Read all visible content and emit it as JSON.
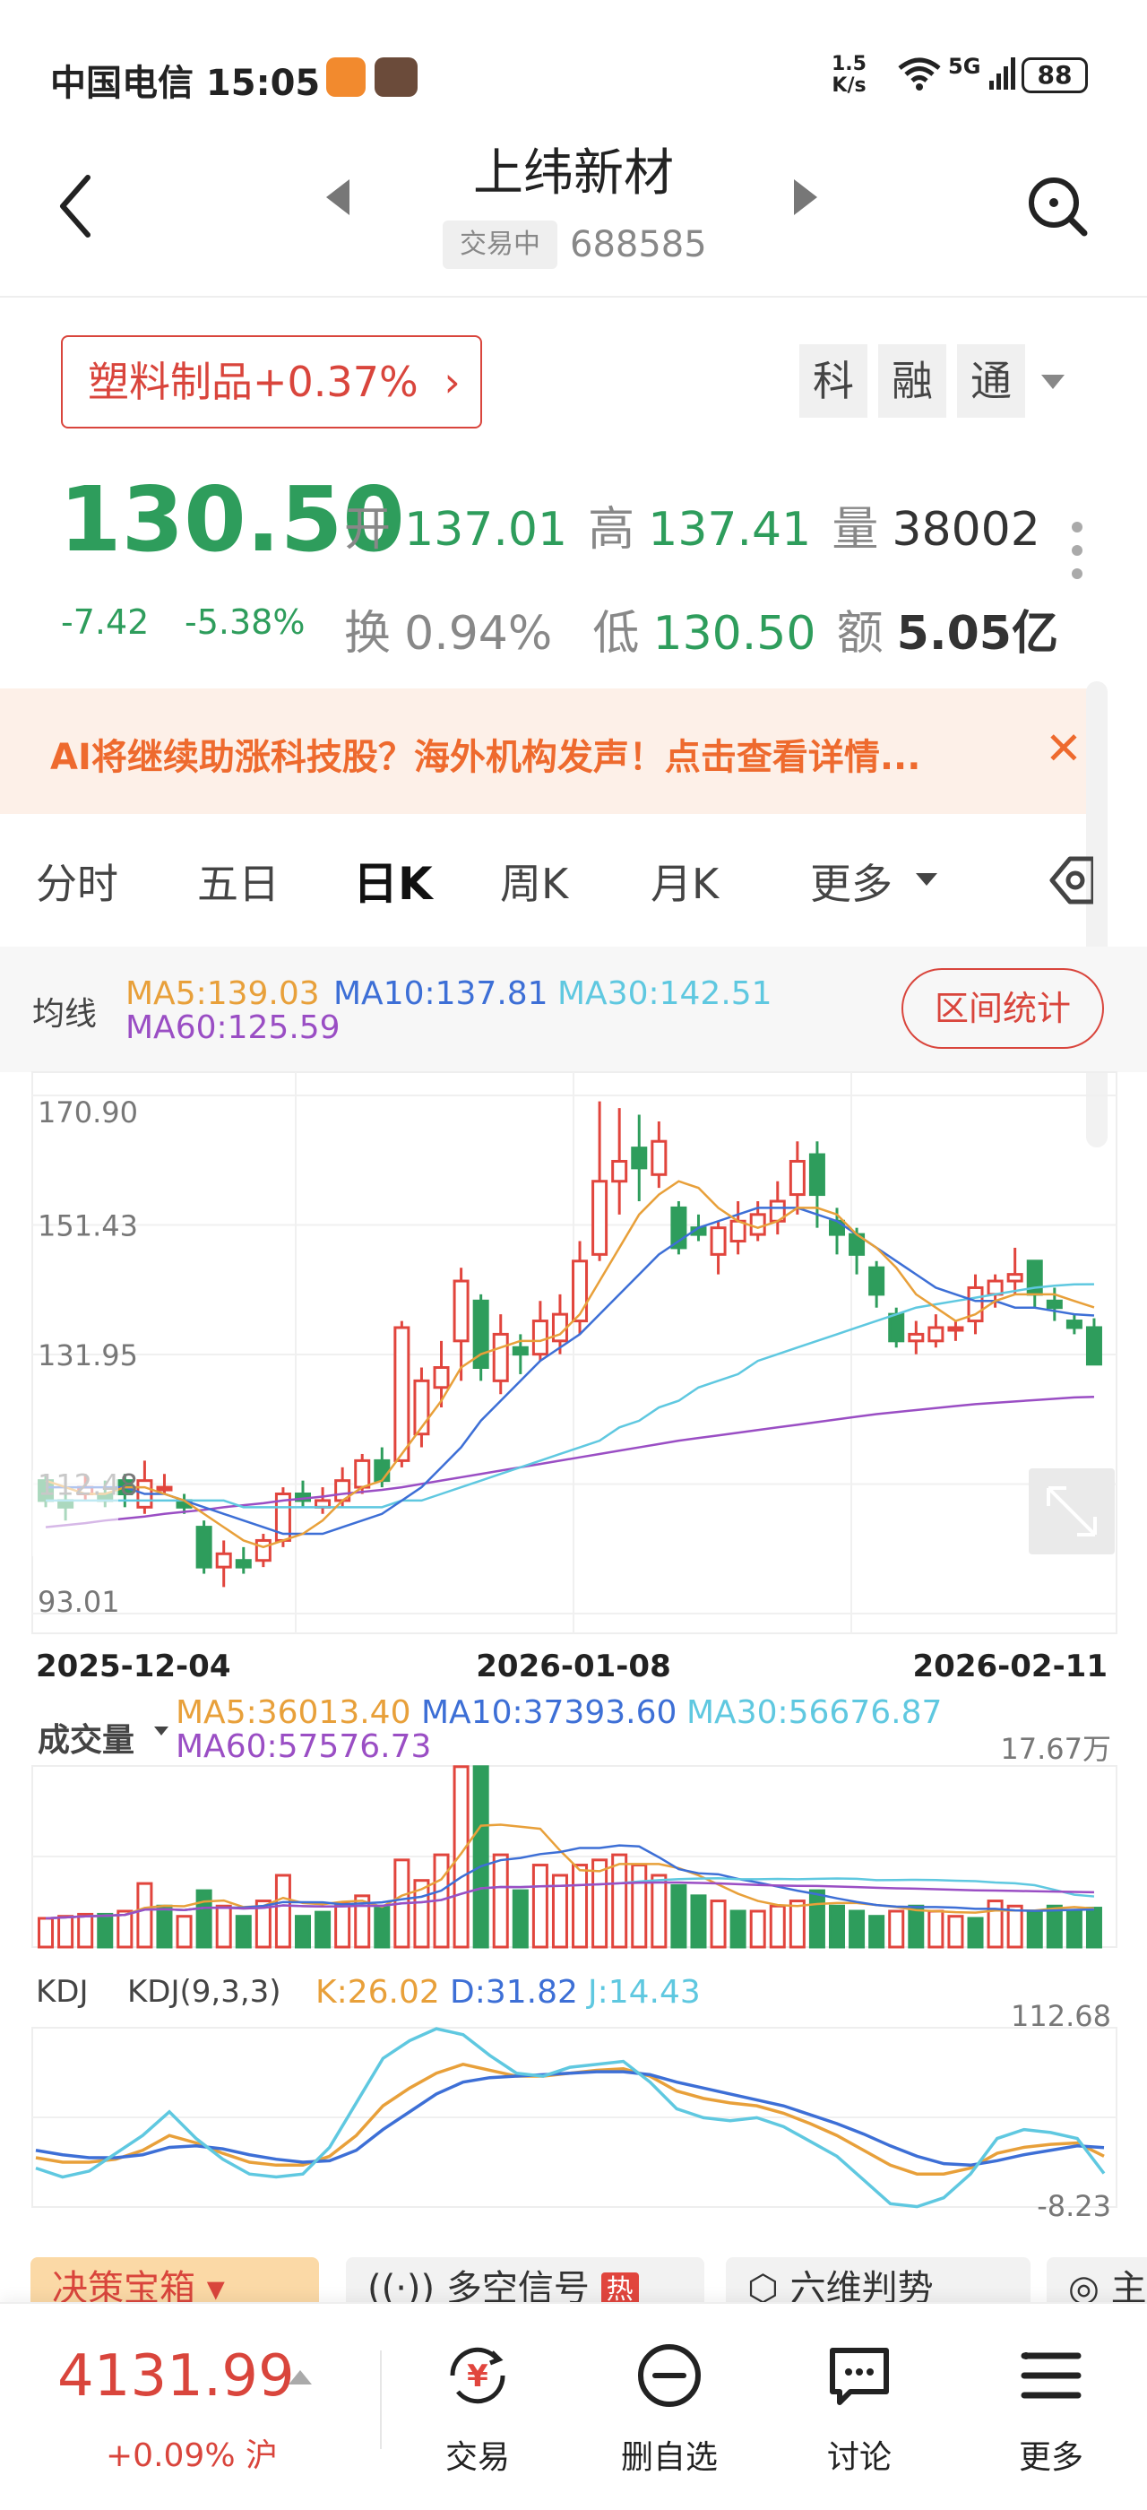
{
  "status_bar": {
    "carrier_time": "中国电信 15:05",
    "net_speed_value": "1.5",
    "net_speed_unit": "K/s",
    "network": "5G",
    "battery": "88"
  },
  "header": {
    "title": "上纬新材",
    "trade_state": "交易中",
    "code": "688585"
  },
  "sector": {
    "label": "塑料制品+0.37%",
    "tags": [
      "科",
      "融",
      "通"
    ]
  },
  "quote": {
    "price": "130.50",
    "change": "-7.42",
    "change_pct": "-5.38%",
    "open_label": "开",
    "open": "137.01",
    "high_label": "高",
    "high": "137.41",
    "volume_label": "量",
    "volume": "38002",
    "turnover_label": "换",
    "turnover": "0.94%",
    "low_label": "低",
    "low": "130.50",
    "amount_label": "额",
    "amount": "5.05亿"
  },
  "banner": {
    "text": "AI将继续助涨科技股？海外机构发声！点击查看详情...",
    "close": "✕"
  },
  "tabs": [
    "分时",
    "五日",
    "日K",
    "周K",
    "月K",
    "更多"
  ],
  "ma_legend": {
    "label": "均线",
    "ma5": "MA5:139.03",
    "ma10": "MA10:137.81",
    "ma30": "MA30:142.51",
    "ma60": "MA60:125.59",
    "range_button": "区间统计"
  },
  "colors": {
    "up": "#e1453d",
    "down": "#2e9d5c",
    "ma5": "#e8a03a",
    "ma10": "#3d6fd6",
    "ma30": "#5fc8e0",
    "ma60": "#9a4ec4"
  },
  "price_axis": [
    "170.90",
    "151.43",
    "131.95",
    "112.48",
    "93.01"
  ],
  "date_axis": [
    "2025-12-04",
    "2026-01-08",
    "2026-02-11"
  ],
  "volume_legend": {
    "label": "成交量",
    "ma5": "MA5:36013.40",
    "ma10": "MA10:37393.60",
    "ma30": "MA30:56676.87",
    "ma60": "MA60:57576.73",
    "max": "17.67万"
  },
  "kdj_legend": {
    "label": "KDJ",
    "param": "KDJ(9,3,3)",
    "k": "K:26.02",
    "d": "D:31.82",
    "j": "J:14.43",
    "max": "112.68",
    "min": "-8.23"
  },
  "chips": [
    "决策宝箱",
    "多空信号",
    "热",
    "六维判势",
    "主"
  ],
  "bottom_nav": {
    "index_value": "4131.99",
    "index_change": "+0.09% 沪",
    "items": [
      "交易",
      "删自选",
      "讨论",
      "更多"
    ]
  },
  "chart_data": [
    {
      "type": "candlestick",
      "ylim": [
        93.01,
        170.9
      ],
      "ticks": [
        "170.90",
        "151.43",
        "131.95",
        "112.48",
        "93.01"
      ],
      "x_labels": [
        "2025-12-04",
        "2026-01-08",
        "2026-02-11"
      ],
      "candles": [
        [
          113,
          110,
          114,
          109
        ],
        [
          110,
          109,
          112,
          107
        ],
        [
          111,
          112,
          114,
          110
        ],
        [
          111,
          110,
          113,
          109
        ],
        [
          113,
          111,
          114,
          109
        ],
        [
          109,
          113,
          116,
          108
        ],
        [
          112,
          112,
          114,
          111
        ],
        [
          110,
          109,
          111,
          108
        ],
        [
          106,
          100,
          107,
          99
        ],
        [
          100,
          102,
          104,
          97
        ],
        [
          101,
          100,
          103,
          99
        ],
        [
          101,
          104,
          105,
          100
        ],
        [
          104,
          111,
          112,
          103
        ],
        [
          111,
          110,
          113,
          109
        ],
        [
          109,
          110,
          112,
          108
        ],
        [
          110,
          113,
          115,
          109
        ],
        [
          112,
          116,
          117,
          111
        ],
        [
          116,
          113,
          118,
          112
        ],
        [
          116,
          136,
          137,
          115
        ],
        [
          120,
          128,
          130,
          118
        ],
        [
          127,
          130,
          134,
          124
        ],
        [
          134,
          143,
          145,
          128
        ],
        [
          140,
          130,
          141,
          128
        ],
        [
          128,
          135,
          138,
          126
        ],
        [
          133,
          132,
          135,
          129
        ],
        [
          132,
          137,
          140,
          131
        ],
        [
          134,
          138,
          141,
          132
        ],
        [
          137,
          146,
          149,
          135
        ],
        [
          147,
          158,
          170,
          146
        ],
        [
          158,
          161,
          169,
          153
        ],
        [
          163,
          160,
          168,
          155
        ],
        [
          159,
          164,
          167,
          157
        ],
        [
          154,
          148,
          155,
          147
        ],
        [
          151,
          150,
          153,
          149
        ],
        [
          147,
          151,
          152,
          144
        ],
        [
          149,
          152,
          155,
          147
        ],
        [
          150,
          153,
          155,
          149
        ],
        [
          152,
          155,
          158,
          150
        ],
        [
          156,
          161,
          164,
          153
        ],
        [
          162,
          156,
          164,
          151
        ],
        [
          152,
          150,
          154,
          147
        ],
        [
          150,
          147,
          151,
          144
        ],
        [
          145,
          141,
          146,
          139
        ],
        [
          138,
          134,
          139,
          133
        ],
        [
          134,
          135,
          137,
          132
        ],
        [
          134,
          136,
          138,
          133
        ],
        [
          136,
          136,
          137,
          134
        ],
        [
          137,
          142,
          144,
          135
        ],
        [
          141,
          143,
          144,
          139
        ],
        [
          143,
          144,
          148,
          141
        ],
        [
          146,
          141,
          146,
          139
        ],
        [
          140,
          139,
          142,
          137
        ],
        [
          137,
          136,
          138,
          135
        ],
        [
          136,
          130.5,
          137.4,
          130.5
        ]
      ],
      "ma5": [
        113,
        112,
        111,
        111,
        112,
        112,
        111,
        110,
        108,
        106,
        104,
        103,
        104,
        105,
        107,
        110,
        112,
        113,
        117,
        121,
        125,
        130,
        132,
        133,
        134,
        134,
        135,
        138,
        143,
        148,
        153,
        156,
        158,
        157,
        154,
        152,
        151,
        152,
        154,
        154,
        153,
        150,
        148,
        145,
        141,
        139,
        137,
        138,
        140,
        141,
        141,
        141,
        140,
        139.03
      ],
      "ma10": [
        112,
        112,
        112,
        112,
        112,
        111,
        111,
        110,
        109,
        108,
        107,
        106,
        105,
        105,
        105,
        106,
        107,
        108,
        110,
        112,
        115,
        118,
        122,
        125,
        128,
        131,
        133,
        135,
        138,
        141,
        144,
        147,
        149,
        151,
        152,
        153,
        154,
        154,
        154,
        153,
        152,
        150,
        148,
        146,
        144,
        142,
        141,
        140,
        140,
        139,
        139,
        138.5,
        138,
        137.81
      ],
      "ma30": [
        110,
        110,
        110,
        110,
        110,
        110,
        110,
        110,
        110,
        110,
        109,
        109,
        109,
        109,
        109,
        109,
        109,
        109,
        110,
        110,
        111,
        112,
        113,
        114,
        115,
        116,
        117,
        118,
        119,
        121,
        122,
        124,
        125,
        127,
        128,
        129,
        131,
        132,
        133,
        134,
        135,
        136,
        137,
        138,
        139,
        139.5,
        140,
        140.5,
        141,
        141.5,
        142,
        142.3,
        142.5,
        142.51
      ],
      "ma60": [
        106,
        106.3,
        106.6,
        107,
        107.3,
        107.6,
        108,
        108.3,
        108.6,
        109,
        109.3,
        109.6,
        110,
        110.3,
        110.6,
        111,
        111.3,
        111.6,
        112,
        112.5,
        113,
        113.5,
        114,
        114.5,
        115,
        115.5,
        116,
        116.5,
        117,
        117.5,
        118,
        118.5,
        119,
        119.4,
        119.8,
        120.2,
        120.6,
        121,
        121.4,
        121.8,
        122.2,
        122.6,
        123,
        123.3,
        123.6,
        123.9,
        124.2,
        124.5,
        124.7,
        124.9,
        125.1,
        125.3,
        125.5,
        125.59
      ]
    },
    {
      "type": "bar",
      "title": "成交量",
      "unit": "万",
      "ylim": [
        0,
        17.67
      ],
      "values": [
        2.8,
        3.0,
        3.2,
        3.2,
        3.5,
        6.2,
        4.0,
        3.0,
        5.5,
        4.0,
        3.0,
        4.5,
        7.0,
        3.0,
        3.4,
        4.2,
        5.0,
        4.0,
        8.5,
        6.5,
        9.0,
        17.6,
        17.6,
        9.0,
        5.5,
        8.0,
        7.0,
        8.0,
        8.5,
        9.0,
        8.0,
        7.0,
        6.0,
        5.0,
        4.5,
        3.5,
        3.5,
        4.0,
        4.5,
        5.5,
        4.0,
        3.5,
        3.0,
        3.5,
        4.0,
        3.5,
        3.0,
        2.8,
        4.5,
        4.0,
        3.5,
        4.0,
        3.5,
        3.8
      ],
      "up": [
        true,
        true,
        true,
        false,
        true,
        true,
        false,
        true,
        false,
        true,
        false,
        true,
        true,
        false,
        false,
        true,
        true,
        false,
        true,
        true,
        true,
        true,
        false,
        true,
        false,
        true,
        true,
        true,
        true,
        true,
        true,
        true,
        false,
        false,
        true,
        false,
        true,
        true,
        true,
        false,
        false,
        false,
        false,
        true,
        false,
        true,
        true,
        false,
        true,
        true,
        false,
        false,
        false,
        false
      ]
    },
    {
      "type": "line",
      "title": "KDJ(9,3,3)",
      "ylim": [
        -8.23,
        112.68
      ],
      "series": [
        {
          "name": "K",
          "values": [
            25,
            22,
            22,
            24,
            30,
            40,
            35,
            28,
            22,
            20,
            20,
            26,
            40,
            60,
            72,
            82,
            88,
            84,
            80,
            80,
            82,
            84,
            85,
            80,
            70,
            65,
            62,
            60,
            55,
            48,
            40,
            30,
            20,
            14,
            14,
            18,
            28,
            32,
            34,
            35,
            26.02
          ]
        },
        {
          "name": "D",
          "values": [
            30,
            27,
            25,
            25,
            27,
            32,
            33,
            31,
            27,
            24,
            22,
            23,
            30,
            44,
            56,
            68,
            76,
            79,
            80,
            81,
            82,
            83,
            83,
            81,
            76,
            72,
            68,
            64,
            60,
            54,
            48,
            41,
            33,
            26,
            21,
            20,
            23,
            27,
            30,
            33,
            31.82
          ]
        },
        {
          "name": "J",
          "values": [
            18,
            12,
            16,
            28,
            40,
            56,
            38,
            24,
            14,
            12,
            14,
            32,
            62,
            92,
            104,
            112,
            108,
            94,
            82,
            80,
            86,
            88,
            90,
            76,
            58,
            52,
            50,
            52,
            46,
            36,
            26,
            10,
            -6,
            -8,
            -2,
            14,
            38,
            44,
            42,
            38,
            14.43
          ]
        }
      ]
    }
  ]
}
